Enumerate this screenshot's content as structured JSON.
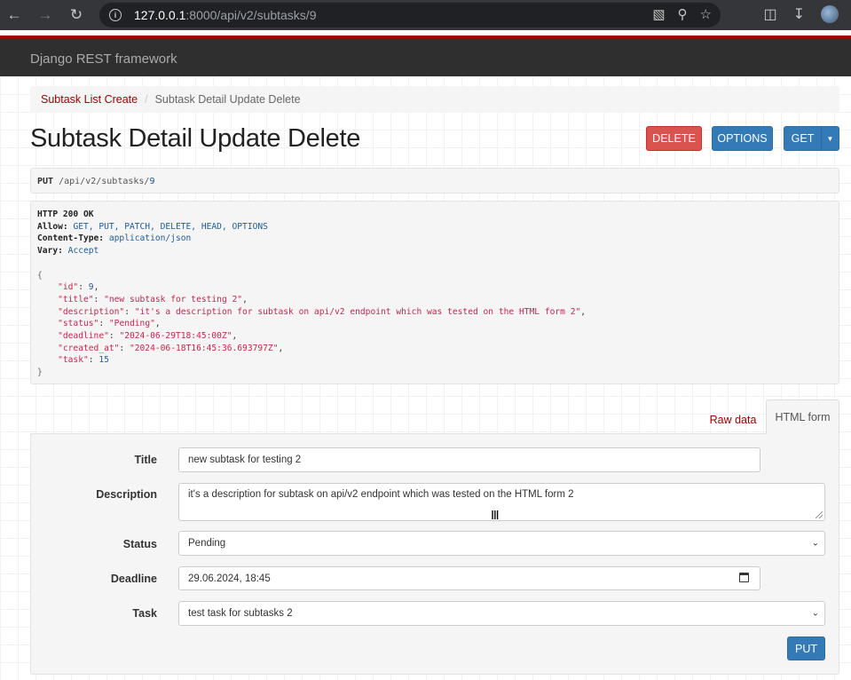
{
  "browser": {
    "url_host": "127.0.0.1",
    "url_path": ":8000/api/v2/subtasks/9"
  },
  "navbar": {
    "brand": "Django REST framework"
  },
  "breadcrumb": {
    "items": [
      "Subtask List Create",
      "Subtask Detail Update Delete"
    ]
  },
  "page": {
    "title": "Subtask Detail Update Delete"
  },
  "actions": {
    "delete_label": "DELETE",
    "options_label": "OPTIONS",
    "get_label": "GET"
  },
  "request": {
    "method": "PUT",
    "path_prefix": "/api/v2/subtasks/",
    "path_id": "9"
  },
  "response": {
    "status_line": "HTTP 200 OK",
    "headers": [
      {
        "name": "Allow:",
        "value": "GET, PUT, PATCH, DELETE, HEAD, OPTIONS"
      },
      {
        "name": "Content-Type:",
        "value": "application/json"
      },
      {
        "name": "Vary:",
        "value": "Accept"
      }
    ],
    "body": {
      "id": "9",
      "title": "\"new subtask for testing 2\"",
      "description": "\"it's a description for subtask on api/v2 endpoint which was tested on the HTML form 2\"",
      "status": "\"Pending\"",
      "deadline": "\"2024-06-29T18:45:00Z\"",
      "created_at": "\"2024-06-18T16:45:36.693797Z\"",
      "task": "15"
    }
  },
  "tabs": {
    "raw": "Raw data",
    "html": "HTML form"
  },
  "form": {
    "title_label": "Title",
    "title_value": "new subtask for testing 2",
    "description_label": "Description",
    "description_value": "it's a description for subtask on api/v2 endpoint which was tested on the HTML form 2",
    "status_label": "Status",
    "status_value": "Pending",
    "deadline_label": "Deadline",
    "deadline_value": "29.06.2024, 18:45",
    "task_label": "Task",
    "task_value": "test task for subtasks 2",
    "submit_label": "PUT"
  }
}
